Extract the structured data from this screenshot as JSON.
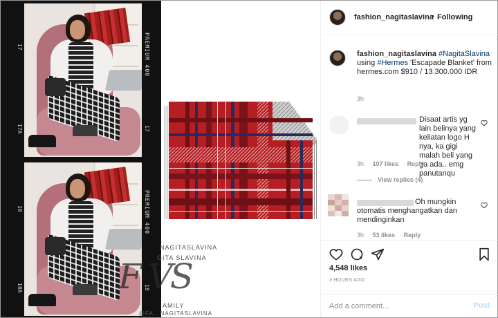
{
  "header": {
    "username": "fashion_nagitaslavina",
    "separator": "•",
    "follow_status": "Following"
  },
  "caption": {
    "username": "fashion_nagitaslavina",
    "tag1": "#NagitaSlavina",
    "text1": "using",
    "tag2": "#Hermes",
    "text2": "'Escapade Blanket' from hermes.com $910 / 13.300.000 IDR",
    "time": "3h"
  },
  "comments": [
    {
      "text": "Disaat artis yg lain belinya yang keliatan logo H nya, ka gigi malah beli yang ga ada.. emg panutanqu",
      "time": "3h",
      "likes": "107 likes",
      "reply": "Reply",
      "view_replies": "View replies (4)"
    },
    {
      "text": "Oh mungkin otomatis menghangatkan dan mendinginkan",
      "time": "3h",
      "likes": "53 likes",
      "reply": "Reply"
    }
  ],
  "post": {
    "likes": "4,548 likes",
    "ago": "3 HOURS AGO"
  },
  "comment_box": {
    "placeholder": "Add a comment...",
    "post_label": "Post"
  },
  "image": {
    "film_stock": "PREMIUM 400",
    "frame_top": "17",
    "frame_bottom": "18",
    "frame_a_top": "17A",
    "frame_a_bottom": "18A",
    "watermark_1": "NAGITASLAVINA",
    "watermark_2": "GITA SLAVINA",
    "watermark_monogram": "F VS",
    "watermark_3": "AMILY",
    "watermark_4": "@FA...NAGITASLAVINA"
  },
  "colors": {
    "link": "#00376b",
    "muted": "#8e8e8e",
    "post_disabled": "#b3dbff",
    "blanket_red": "#b51f24"
  },
  "icons": [
    "heart-icon",
    "comment-icon",
    "share-icon",
    "bookmark-icon"
  ]
}
